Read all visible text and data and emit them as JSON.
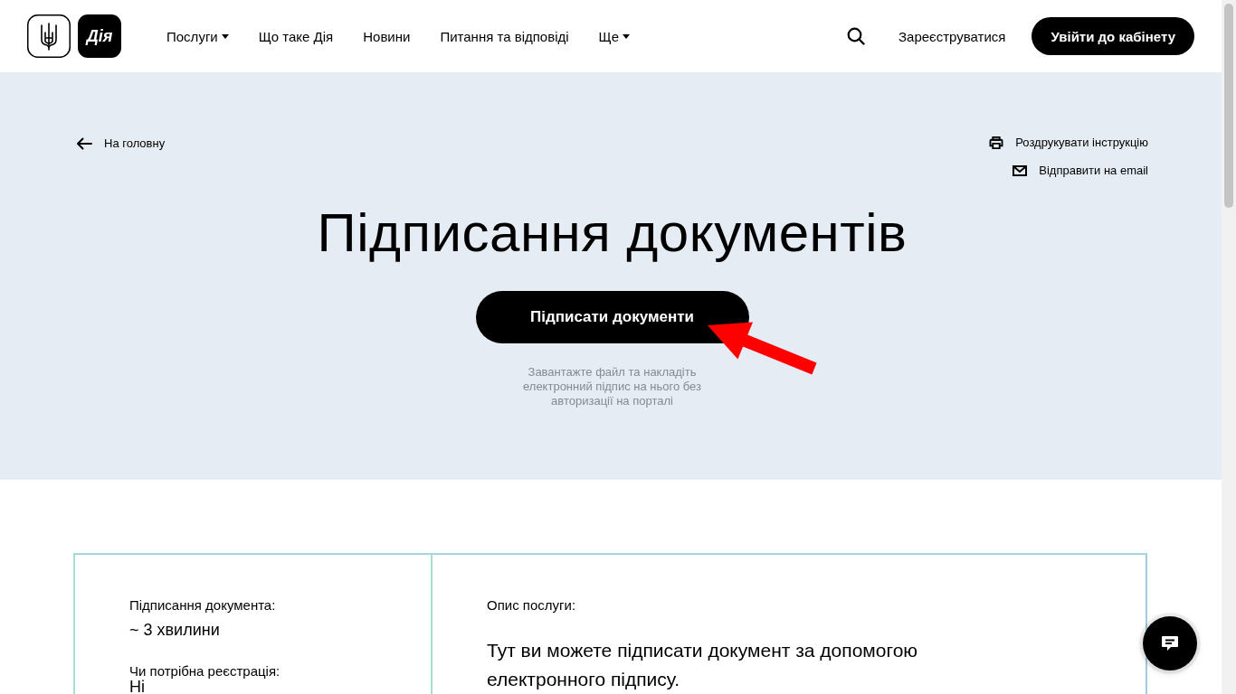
{
  "header": {
    "logo_text": "Дія",
    "nav": [
      {
        "label": "Послуги",
        "dropdown": true
      },
      {
        "label": "Що таке Дія",
        "dropdown": false
      },
      {
        "label": "Новини",
        "dropdown": false
      },
      {
        "label": "Питання та відповіді",
        "dropdown": false
      },
      {
        "label": "Ще",
        "dropdown": true
      }
    ],
    "register_link": "Зареєструватися",
    "login_button": "Увійти до кабінету"
  },
  "hero": {
    "back_link": "На головну",
    "actions": [
      {
        "kind": "print",
        "label": "Роздрукувати інструкцію"
      },
      {
        "kind": "email",
        "label": "Відправити на email"
      }
    ],
    "title": "Підписання документів",
    "primary_button": "Підписати документи",
    "caption": "Завантажте файл та накладіть електронний підпис на нього без авторизації на порталі"
  },
  "details": {
    "facts": [
      {
        "label": "Підписання документа:",
        "value": "~ 3 хвилини"
      },
      {
        "label": "Чи потрібна реєстрація:",
        "value": "Ні"
      }
    ],
    "description_label": "Опис послуги:",
    "description": "Тут ви можете підписати документ за допомогою електронного підпису."
  }
}
